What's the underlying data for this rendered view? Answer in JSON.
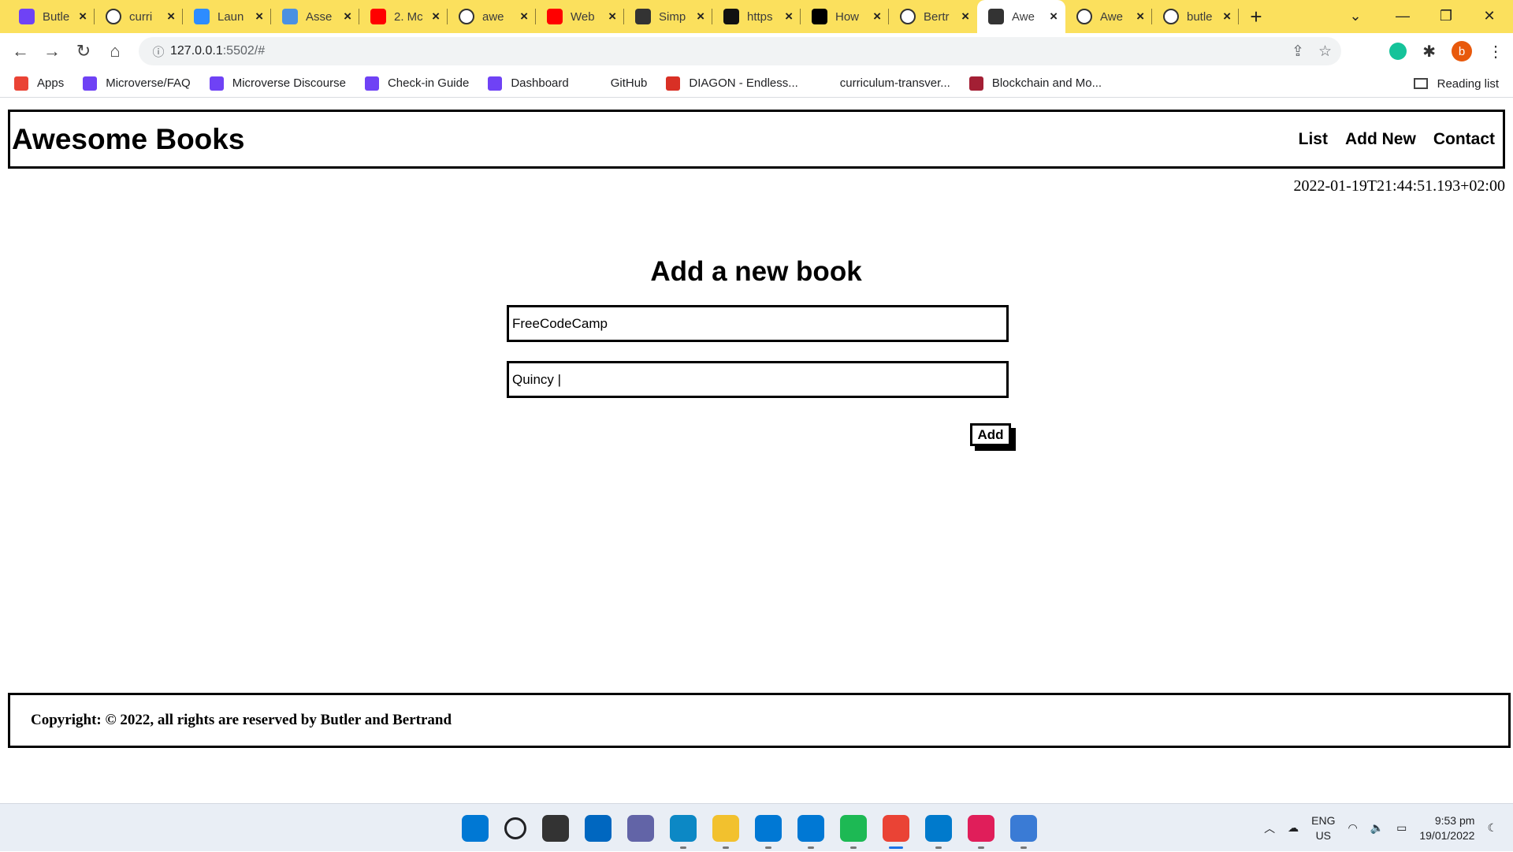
{
  "browser": {
    "tabs": [
      {
        "title": "Butle",
        "favicon": "microverse-icon",
        "color": "#6f42f5"
      },
      {
        "title": "curri",
        "favicon": "github-icon",
        "color": "#ffffff"
      },
      {
        "title": "Laun",
        "favicon": "zoom-icon",
        "color": "#2d8cff"
      },
      {
        "title": "Asse",
        "favicon": "asset-icon",
        "color": "#4a90e2"
      },
      {
        "title": "2. Mc",
        "favicon": "youtube-icon",
        "color": "#ff0000"
      },
      {
        "title": "awe",
        "favicon": "github-icon",
        "color": "#ffffff"
      },
      {
        "title": "Web",
        "favicon": "youtube-icon",
        "color": "#ff0000"
      },
      {
        "title": "Simp",
        "favicon": "globe-icon",
        "color": "#333333"
      },
      {
        "title": "https",
        "favicon": "code-icon",
        "color": "#111111"
      },
      {
        "title": "How",
        "favicon": "dev-icon",
        "color": "#000000"
      },
      {
        "title": "Bertr",
        "favicon": "github-icon",
        "color": "#ffffff"
      },
      {
        "title": "Awe",
        "favicon": "globe-icon",
        "color": "#333333",
        "active": true
      },
      {
        "title": "Awe",
        "favicon": "github-icon",
        "color": "#ffffff"
      },
      {
        "title": "butle",
        "favicon": "github-icon",
        "color": "#ffffff"
      }
    ],
    "new_tab": "+",
    "url_host": "127.0.0.1",
    "url_rest": ":5502/#",
    "profile_initial": "b",
    "bookmarks": [
      {
        "label": "Apps",
        "icon": "apps-grid-icon",
        "color": "#ea4335"
      },
      {
        "label": "Microverse/FAQ",
        "icon": "microverse-icon",
        "color": "#6f42f5"
      },
      {
        "label": "Microverse Discourse",
        "icon": "microverse-icon",
        "color": "#6f42f5"
      },
      {
        "label": "Check-in Guide",
        "icon": "microverse-icon",
        "color": "#6f42f5"
      },
      {
        "label": "Dashboard",
        "icon": "microverse-icon",
        "color": "#6f42f5"
      },
      {
        "label": "GitHub",
        "icon": "blank-icon",
        "color": "#ffffff"
      },
      {
        "label": "DIAGON - Endless...",
        "icon": "diagon-icon",
        "color": "#d93025"
      },
      {
        "label": "curriculum-transver...",
        "icon": "blank-icon",
        "color": "#ffffff"
      },
      {
        "label": "Blockchain and Mo...",
        "icon": "mit-icon",
        "color": "#a31f34"
      }
    ],
    "reading_list": "Reading list"
  },
  "site": {
    "brand": "Awesome Books",
    "nav": [
      "List",
      "Add New",
      "Contact"
    ],
    "datetime": "2022-01-19T21:44:51.193+02:00",
    "form": {
      "title": "Add a new book",
      "title_value": "FreeCodeCamp",
      "author_value": "Quincy |",
      "add_label": "Add"
    },
    "footer": "Copyright: © 2022, all rights are reserved by Butler and Bertrand"
  },
  "taskbar": {
    "apps": [
      {
        "name": "windows-start-icon",
        "color": "#0078d4"
      },
      {
        "name": "search-icon",
        "color": "#202124"
      },
      {
        "name": "task-view-icon",
        "color": "#333333"
      },
      {
        "name": "widgets-icon",
        "color": "#0067c0"
      },
      {
        "name": "teams-chat-icon",
        "color": "#6264a7"
      },
      {
        "name": "edge-icon",
        "color": "#0c88c5"
      },
      {
        "name": "file-explorer-icon",
        "color": "#f2c12e"
      },
      {
        "name": "mail-icon",
        "color": "#0078d4"
      },
      {
        "name": "store-icon",
        "color": "#0078d4"
      },
      {
        "name": "spotify-icon",
        "color": "#1db954"
      },
      {
        "name": "chrome-icon",
        "color": "#ea4335",
        "active": true
      },
      {
        "name": "vscode-icon",
        "color": "#007acc"
      },
      {
        "name": "slack-icon",
        "color": "#e01e5a"
      },
      {
        "name": "photos-icon",
        "color": "#3a7bd5"
      }
    ],
    "lang_top": "ENG",
    "lang_bottom": "US",
    "time": "9:53 pm",
    "date": "19/01/2022"
  }
}
